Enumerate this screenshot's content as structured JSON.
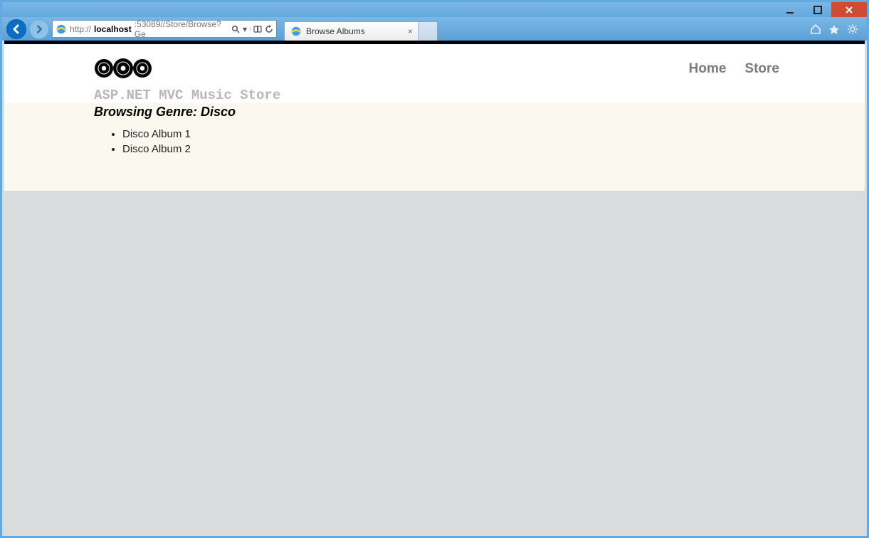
{
  "browser": {
    "url_prefix": "http://",
    "url_host": "localhost",
    "url_rest": ":53089//Store/Browse?Ge",
    "tab_title": "Browse Albums"
  },
  "nav": {
    "home": "Home",
    "store": "Store"
  },
  "brand_text": "ASP.NET MVC Music Store",
  "page": {
    "heading": "Browsing Genre: Disco",
    "albums": [
      "Disco Album 1",
      "Disco Album 2"
    ]
  }
}
